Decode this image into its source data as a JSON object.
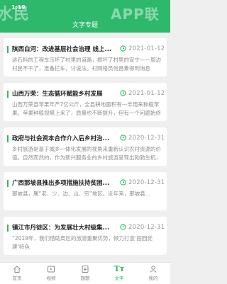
{
  "status_bar": {
    "time": "1:19"
  },
  "watermark": {
    "left": "水民",
    "right": "APP联"
  },
  "header": {
    "title": "文字专题"
  },
  "articles": [
    {
      "title": "陕西白河：改进基层社会治理 线上...",
      "date": "2021-01-12",
      "summary": "这石料的工程车压坏了村里的道路，损坏了村里的安宁——周边村民不干了，准备拦车，讨说法。村网格员何昌秦得到消息"
    },
    {
      "title": "山西万荣：生态循环赋能乡村发展",
      "date": "2021-01-12",
      "summary": "山西万荣县苹果年产7亿公斤，全县耕地面积有一半用来种植苹果。苹果种植规模上来了，质量也不断提升，但有一个问题始终"
    },
    {
      "title": "政府与社会资本合作介入后乡村治...",
      "date": "2020-12-31",
      "summary": "乡村旅游是基于城乡一体化发展的视角来重新认识农村资源的价值。自然而然的，作为新兴服务业的乡村旅游呈现出勃勃生机，"
    },
    {
      "title": "广西那坡县推出多项措施扶持贫困...",
      "date": "2020-12-31",
      "summary": "那坡县，属“老、少、边、山、穷”地区。近年来，那坡县..."
    },
    {
      "title": "镇江市丹徒区：为发展壮大村级集...",
      "date": "2020-12-31",
      "summary": "“2019年，我们借助周区的旅游重聚优势，倾力打造‘田园党建’特色"
    }
  ],
  "tabs": [
    {
      "label": "首页",
      "icon": "home-icon"
    },
    {
      "label": "视频",
      "icon": "video-icon"
    },
    {
      "label": "题题",
      "icon": "topic-icon"
    },
    {
      "label": "文字",
      "icon": "text-icon",
      "glyph": "Tт"
    },
    {
      "label": "我的",
      "icon": "profile-icon"
    }
  ],
  "colors": {
    "accent": "#2db86b",
    "title_text": "#222222",
    "muted_text": "#8c8c8c"
  }
}
